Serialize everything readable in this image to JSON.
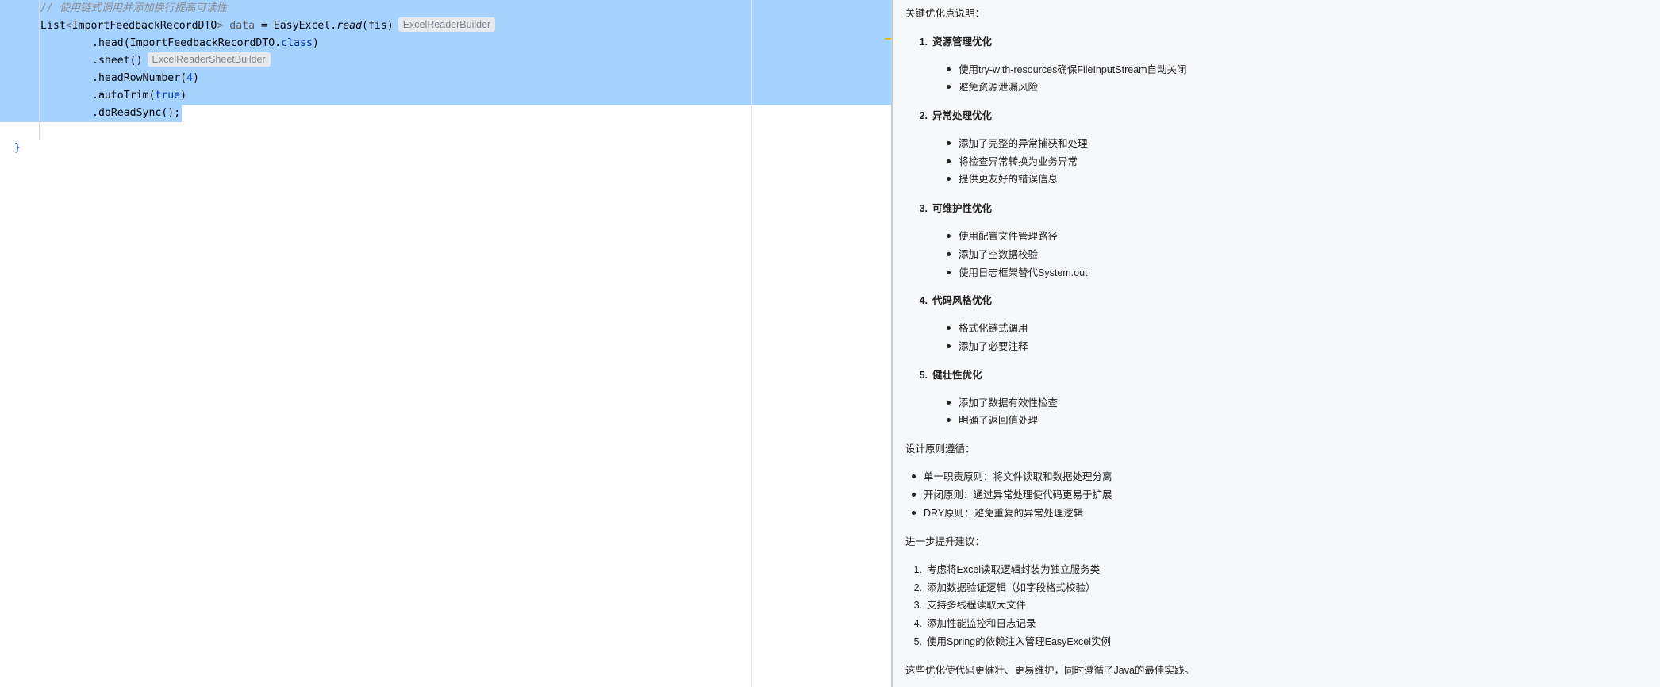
{
  "editor": {
    "comment": "// 使用链式调用并添加换行提高可读性",
    "line1": {
      "type_name": "List",
      "generic_open": "<",
      "generic_type": "ImportFeedbackRecordDTO",
      "generic_close": ">",
      "var_name": "data",
      "assign": " = ",
      "class_name": "EasyExcel.",
      "method": "read",
      "args": "(fis)",
      "hint": "ExcelReaderBuilder"
    },
    "line2": {
      "call": ".head(ImportFeedbackRecordDTO.",
      "kw": "class",
      "close": ")"
    },
    "line3": {
      "call": ".sheet()",
      "hint": "ExcelReaderSheetBuilder"
    },
    "line4": {
      "call": ".headRowNumber(",
      "num": "4",
      "close": ")"
    },
    "line5": {
      "call": ".autoTrim(",
      "kw": "true",
      "close": ")"
    },
    "line6": {
      "call": ".doReadSync();"
    },
    "closing_brace": "}",
    "colors": {
      "selection": "#a6d2ff",
      "keyword": "#0033b3",
      "comment": "#8c8c8c",
      "marker": "#e6b422"
    }
  },
  "panel": {
    "intro": "关键优化点说明：",
    "sections": [
      {
        "num": "1.",
        "title": "资源管理优化",
        "bullets": [
          "使用try-with-resources确保FileInputStream自动关闭",
          "避免资源泄漏风险"
        ]
      },
      {
        "num": "2.",
        "title": "异常处理优化",
        "bullets": [
          "添加了完整的异常捕获和处理",
          "将检查异常转换为业务异常",
          "提供更友好的错误信息"
        ]
      },
      {
        "num": "3.",
        "title": "可维护性优化",
        "bullets": [
          "使用配置文件管理路径",
          "添加了空数据校验",
          "使用日志框架替代System.out"
        ]
      },
      {
        "num": "4.",
        "title": "代码风格优化",
        "bullets": [
          "格式化链式调用",
          "添加了必要注释"
        ]
      },
      {
        "num": "5.",
        "title": "健壮性优化",
        "bullets": [
          "添加了数据有效性检查",
          "明确了返回值处理"
        ]
      }
    ],
    "principles_heading": "设计原则遵循：",
    "principles": [
      "单一职责原则：将文件读取和数据处理分离",
      "开闭原则：通过异常处理使代码更易于扩展",
      "DRY原则：避免重复的异常处理逻辑"
    ],
    "suggestions_heading": "进一步提升建议：",
    "suggestions": [
      {
        "num": "1.",
        "text": "考虑将Excel读取逻辑封装为独立服务类"
      },
      {
        "num": "2.",
        "text": "添加数据验证逻辑（如字段格式校验）"
      },
      {
        "num": "3.",
        "text": "支持多线程读取大文件"
      },
      {
        "num": "4.",
        "text": "添加性能监控和日志记录"
      },
      {
        "num": "5.",
        "text": "使用Spring的依赖注入管理EasyExcel实例"
      }
    ],
    "conclusion": "这些优化使代码更健壮、更易维护，同时遵循了Java的最佳实践。"
  }
}
